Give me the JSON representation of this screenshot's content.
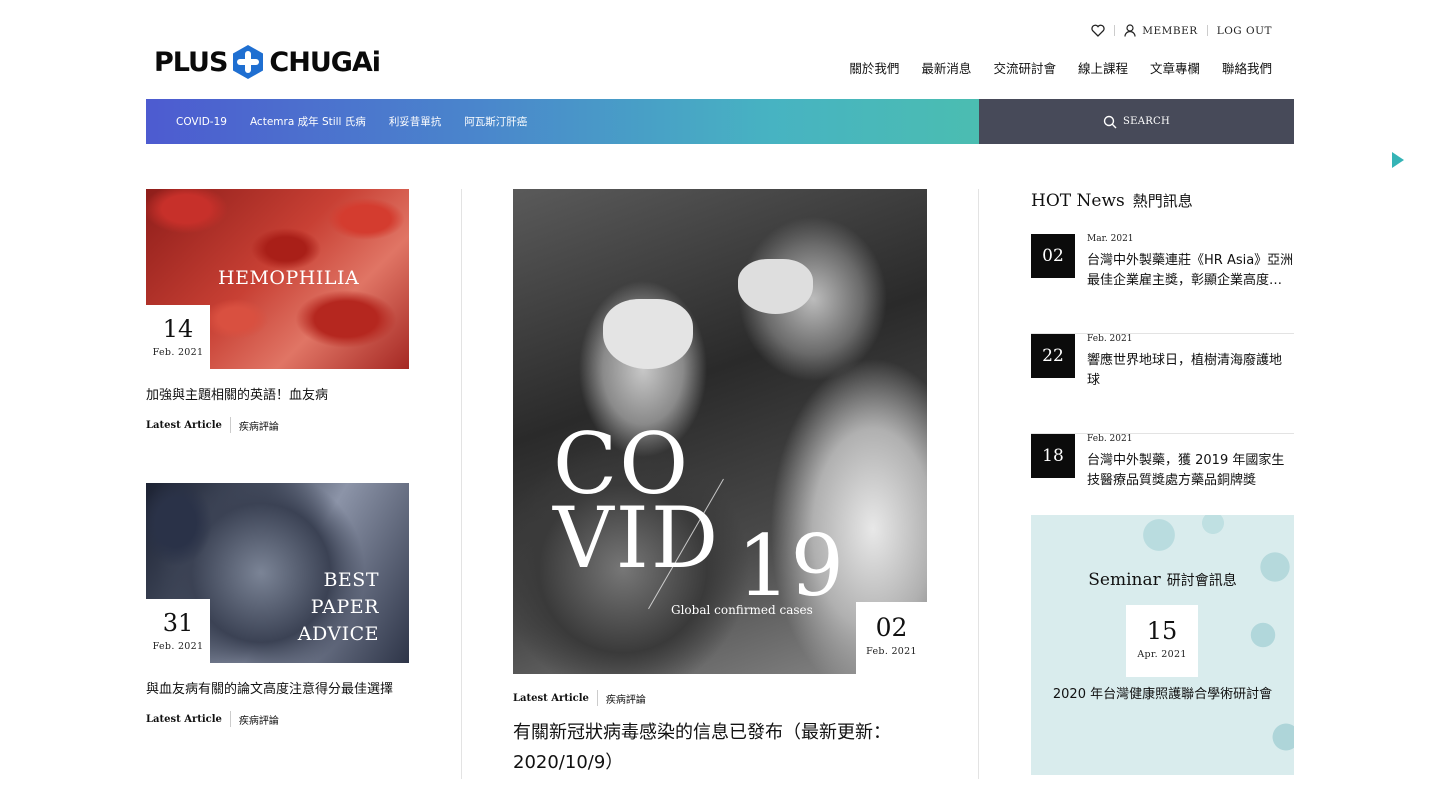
{
  "logo": {
    "left": "PLUS",
    "right": "CHUGAi"
  },
  "utility": {
    "member": "MEMBER",
    "logout": "LOG OUT"
  },
  "nav": [
    "關於我們",
    "最新消息",
    "交流研討會",
    "線上課程",
    "文章專欄",
    "聯絡我們"
  ],
  "categories": [
    "COVID-19",
    "Actemra 成年 Still 氏病",
    "利妥昔單抗",
    "阿瓦斯汀肝癌"
  ],
  "search": {
    "label": "SEARCH"
  },
  "colors": {
    "accent_bar_start": "#4d5bd0",
    "accent_bar_end": "#4bbdb1",
    "search_bg": "#474a59",
    "arrow": "#35b4b6"
  },
  "left_articles": [
    {
      "image_title": "HEMOPHILIA",
      "day": "14",
      "month": "Feb. 2021",
      "title": "加強與主題相關的英語！血友病",
      "tag1": "Latest Article",
      "tag2": "疾病評論"
    },
    {
      "image_title_line1": "BEST PAPER",
      "image_title_line2": "ADVICE",
      "day": "31",
      "month": "Feb. 2021",
      "title": "與血友病有關的論文高度注意得分最佳選擇",
      "tag1": "Latest Article",
      "tag2": "疾病評論"
    }
  ],
  "feature": {
    "image_text_line1": "CO",
    "image_text_line2": "VID",
    "image_text_num": "19",
    "image_sub": "Global confirmed cases",
    "day": "02",
    "month": "Feb. 2021",
    "tag1": "Latest Article",
    "tag2": "疾病評論",
    "title": "有關新冠狀病毒感染的信息已發布（最新更新：2020/10/9）"
  },
  "hot_news": {
    "heading_en": "HOT News",
    "heading_zh": "熱門訊息",
    "items": [
      {
        "day": "02",
        "month": "Mar. 2021",
        "title": "台灣中外製藥連莊《HR Asia》亞洲最佳企業雇主獎，彰顯企業高度重視人才"
      },
      {
        "day": "22",
        "month": "Feb. 2021",
        "title": "響應世界地球日，植樹清海廢護地球"
      },
      {
        "day": "18",
        "month": "Feb. 2021",
        "title": "台灣中外製藥，獲 2019 年國家生技醫療品質獎處方藥品銅牌獎"
      }
    ]
  },
  "seminar": {
    "heading_en": "Seminar",
    "heading_zh": "研討會訊息",
    "day": "15",
    "month": "Apr. 2021",
    "title": "2020 年台灣健康照護聯合學術研討會"
  }
}
